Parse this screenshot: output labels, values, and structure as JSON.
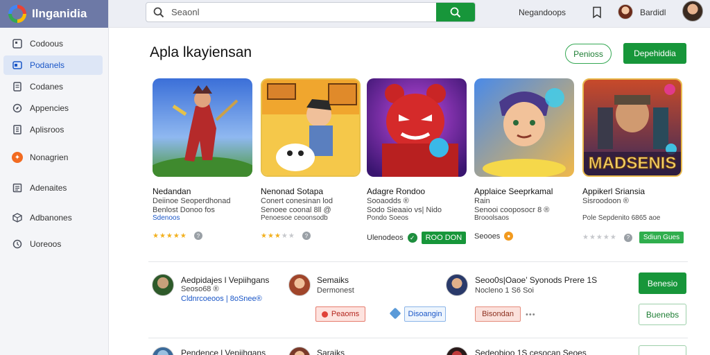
{
  "brand": {
    "name": "Ilnganidia"
  },
  "sidebar": {
    "items": [
      {
        "label": "Codoous",
        "icon": "apps-icon",
        "active": false
      },
      {
        "label": "Podanels",
        "icon": "apps-icon",
        "active": true
      },
      {
        "label": "Codanes",
        "icon": "document-icon",
        "active": false
      },
      {
        "label": "Appencies",
        "icon": "compass-icon",
        "active": false
      },
      {
        "label": "Aplisroos",
        "icon": "list-icon",
        "active": false
      },
      {
        "label": "Nonagrien",
        "icon": "orange-badge-icon",
        "active": false
      },
      {
        "label": "Adenaites",
        "icon": "list-icon",
        "active": false
      },
      {
        "label": "Adbanones",
        "icon": "package-icon",
        "active": false
      },
      {
        "label": "Uoreoos",
        "icon": "history-icon",
        "active": false
      }
    ]
  },
  "topbar": {
    "search_placeholder": "Seaonl",
    "link": "Negandoops",
    "user": "Bardidl"
  },
  "main": {
    "title": "Apla lkayiensan",
    "outline_button": "Penioss",
    "primary_button": "Depehiddia"
  },
  "cards": [
    {
      "title": "Nedandan",
      "line2": "Deiinoe Seoperdhonad",
      "line3": "Benlost Donoo fos",
      "line4": "Sdenoos",
      "meta": "",
      "rating": "4.5"
    },
    {
      "title": "Nenonad Sotapa",
      "line2": "Conert conesinan lod",
      "line3": "Senoee coonal 8ll @",
      "line4": "Penoesoe ceoonsodb",
      "meta": "",
      "rating": "3.5"
    },
    {
      "title": "Adagre Rondoo",
      "line2": "Sooaodds ®",
      "line3": "Sodo Sieaaio vs| Nido",
      "line4": "Pondo Soeos",
      "meta": "Ulenodeos",
      "tag": "ROO DON"
    },
    {
      "title": "Applaice Seeprkamal",
      "line2": "Rain",
      "line3": "Senooi cooposocr 8 ®",
      "line4": "Brooolsaos",
      "meta": "Seooes"
    },
    {
      "title": "Appikerl Sriansia",
      "line2": "Sisroodoon ®",
      "line3": "",
      "line4": "Pole Sepdenito 6865 aoe",
      "meta": "",
      "tag": "Sdiun Gues"
    }
  ],
  "list": [
    {
      "title": "Aedpidajes l Vepiihgans",
      "sub1": "Seoso68 ®",
      "sub2": "Cldnrcoeoos | 8oSnee®",
      "person": "Semaiks",
      "person_sub": "Dermonest",
      "right_title": "Seoo0s|Oaoe’ Syonods Prere 1S",
      "right_sub": "Nocleno 1 S6 Soi",
      "chip1": "Peaoms",
      "chip2": "Disoangin",
      "chip3": "Bisondan",
      "btn1": "Benesio",
      "btn2": "Buenebs"
    },
    {
      "title": "Pendence l Vepiihgans",
      "person": "Saraiks",
      "right_title": "Sedeobioo 1S cesocan Seoes"
    }
  ],
  "colors": {
    "accent_green": "#17963a",
    "brand_bar": "#6d79a6",
    "active_nav": "#dde6f6"
  }
}
